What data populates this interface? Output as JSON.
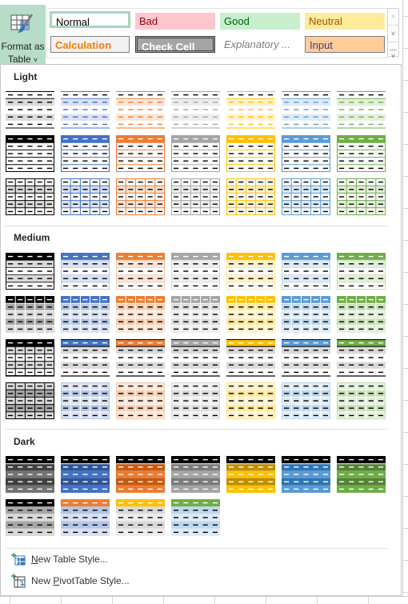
{
  "ribbon": {
    "format_as_table": {
      "label_line1": "Format as",
      "label_line2": "Table",
      "icon": "format-as-table-icon"
    },
    "cell_styles": [
      {
        "label": "Normal",
        "bg": "#ffffff",
        "color": "#000000",
        "border": "#a8d5bb",
        "italic": false,
        "bold": false
      },
      {
        "label": "Bad",
        "bg": "#ffc7ce",
        "color": "#9c0006",
        "border": "none",
        "italic": false,
        "bold": false
      },
      {
        "label": "Good",
        "bg": "#c6efce",
        "color": "#006100",
        "border": "none",
        "italic": false,
        "bold": false
      },
      {
        "label": "Neutral",
        "bg": "#ffeb9c",
        "color": "#9c5700",
        "border": "none",
        "italic": false,
        "bold": false
      },
      {
        "label": "Calculation",
        "bg": "#f2f2f2",
        "color": "#fa7d00",
        "border": "#7f7f7f",
        "italic": false,
        "bold": true
      },
      {
        "label": "Check Cell",
        "bg": "#a5a5a5",
        "color": "#ffffff",
        "border": "#3f3f3f",
        "italic": false,
        "bold": true
      },
      {
        "label": "Explanatory ...",
        "bg": "#ffffff",
        "color": "#7f7f7f",
        "border": "none",
        "italic": true,
        "bold": false
      },
      {
        "label": "Input",
        "bg": "#ffcc99",
        "color": "#3f3f76",
        "border": "#7f7f7f",
        "italic": false,
        "bold": false
      }
    ],
    "scroll": {
      "up": "^",
      "down": "v",
      "more": "more-icon"
    }
  },
  "dropdown": {
    "sections": [
      {
        "title": "Light"
      },
      {
        "title": "Medium"
      },
      {
        "title": "Dark"
      }
    ],
    "theme_colors": [
      {
        "name": "Black",
        "main": "#000000",
        "light": "#d9d9d9",
        "lighter": "#f2f2f2",
        "dark": "#404040",
        "med": "#a6a6a6"
      },
      {
        "name": "Blue",
        "main": "#4472c4",
        "light": "#d9e1f2",
        "lighter": "#eef2fa",
        "dark": "#2f5597",
        "med": "#b4c6e7"
      },
      {
        "name": "Orange",
        "main": "#ed7d31",
        "light": "#fce4d6",
        "lighter": "#fdf1ea",
        "dark": "#c55a11",
        "med": "#f8cbad"
      },
      {
        "name": "Gray",
        "main": "#a5a5a5",
        "light": "#ededed",
        "lighter": "#f6f6f6",
        "dark": "#7b7b7b",
        "med": "#dbdbdb"
      },
      {
        "name": "Gold",
        "main": "#ffc000",
        "light": "#fff2cc",
        "lighter": "#fff9e6",
        "dark": "#bf8f00",
        "med": "#ffe699"
      },
      {
        "name": "LightBlue",
        "main": "#5b9bd5",
        "light": "#ddebf7",
        "lighter": "#eef5fb",
        "dark": "#2e75b6",
        "med": "#bdd7ee"
      },
      {
        "name": "Green",
        "main": "#70ad47",
        "light": "#e2efda",
        "lighter": "#f0f7ec",
        "dark": "#548235",
        "med": "#c6e0b4"
      }
    ],
    "light_styles": [
      {
        "kind": "light-banded"
      },
      {
        "kind": "light-header"
      },
      {
        "kind": "light-grid"
      }
    ],
    "medium_styles": [
      {
        "kind": "medium-banded"
      },
      {
        "kind": "medium-grid-header"
      },
      {
        "kind": "medium-gray-banded"
      },
      {
        "kind": "medium-grid"
      }
    ],
    "dark_styles": [
      {
        "kind": "dark-banded",
        "count": 7
      },
      {
        "kind": "dark-light-banded",
        "count": 4
      }
    ],
    "menu": [
      {
        "label": "New Table Style...",
        "mnemonic": "N",
        "icon": "new-table-style-icon"
      },
      {
        "label": "New PivotTable Style...",
        "mnemonic": "P",
        "icon": "new-pivottable-style-icon"
      }
    ],
    "grip": "....."
  }
}
